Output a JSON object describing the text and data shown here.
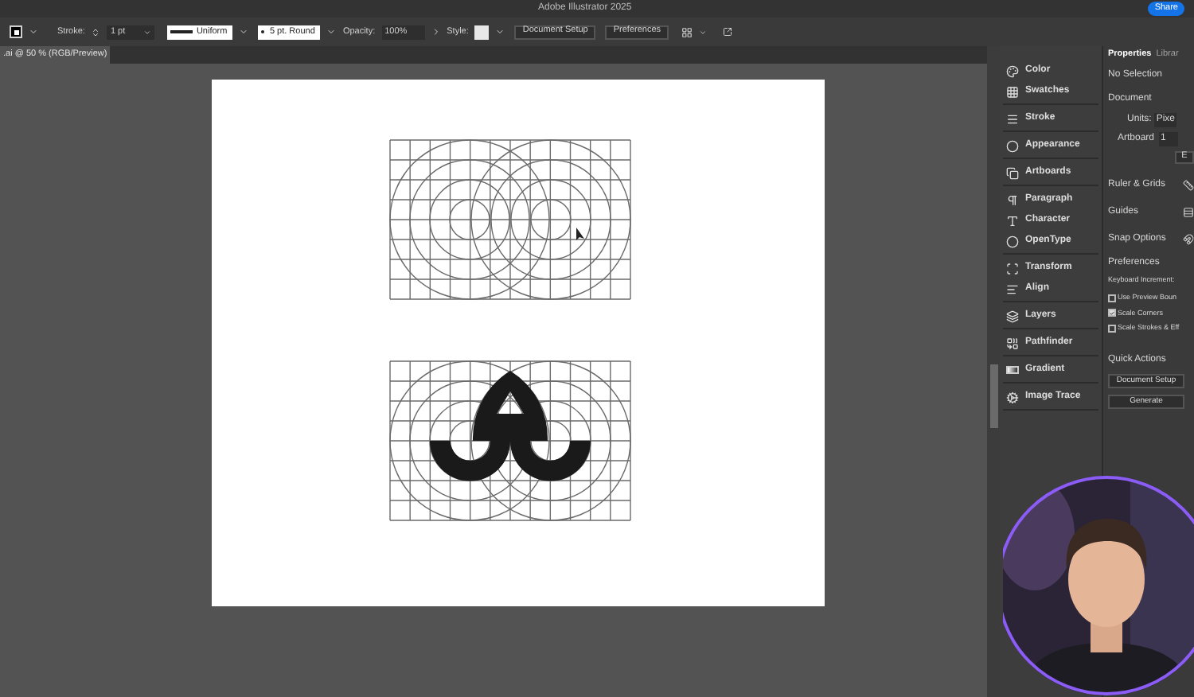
{
  "window": {
    "title": "Adobe Illustrator 2025",
    "share": "Share"
  },
  "control_bar": {
    "stroke_label": "Stroke:",
    "stroke_weight": "1 pt",
    "profile": "Uniform",
    "brush": "5 pt. Round",
    "opacity_label": "Opacity:",
    "opacity": "100%",
    "style_label": "Style:",
    "buttons": [
      "Document Setup",
      "Preferences"
    ]
  },
  "document_tab": {
    "label": ".ai @ 50 % (RGB/Preview)",
    "selected": true
  },
  "panel_dock": [
    [
      "Color",
      "Swatches"
    ],
    [
      "Stroke"
    ],
    [
      "Appearance"
    ],
    [
      "Artboards"
    ],
    [
      "Paragraph",
      "Character",
      "OpenType"
    ],
    [
      "Transform",
      "Align"
    ],
    [
      "Layers"
    ],
    [
      "Pathfinder"
    ],
    [
      "Gradient"
    ],
    [
      "Image Trace"
    ]
  ],
  "properties": {
    "tabs": [
      {
        "label": "Properties",
        "selected": true
      },
      {
        "label": "Librar",
        "selected": false
      }
    ],
    "selection": "No Selection",
    "document": "Document",
    "units_label": "Units:",
    "units": "Pixe",
    "artboard_label": "Artboard",
    "artboard": "1",
    "edit_button": "E",
    "sections": [
      "Ruler & Grids",
      "Guides",
      "Snap Options"
    ],
    "preferences": "Preferences",
    "keyboard_increment": "Keyboard Increment:",
    "checkboxes": [
      {
        "label": "Use Preview Boun",
        "checked": false
      },
      {
        "label": "Scale Corners",
        "checked": true
      },
      {
        "label": "Scale Strokes & Eff",
        "checked": false
      }
    ],
    "quick_actions": "Quick Actions",
    "buttons": [
      "Document Setup",
      "Generate"
    ]
  },
  "webcam": {
    "kind": "picture"
  }
}
